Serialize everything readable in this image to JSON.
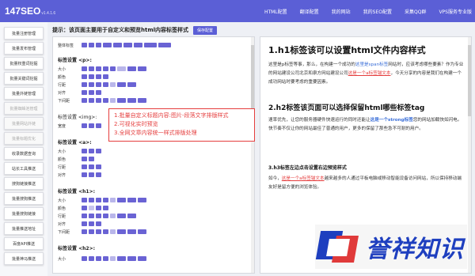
{
  "app": {
    "name": "147SEO",
    "version": "v1.4.1.6"
  },
  "nav": [
    "HTML配置",
    "翻译配置",
    "我的网站",
    "我的SEO配置",
    "采集QQ群",
    "VPS服务专业版"
  ],
  "sidebar": [
    "批量注册管理",
    "批量发布管理",
    "批量权重词挖掘",
    "批量关键词挖掘",
    "批量外链管理",
    "批量蜘蛛池管理",
    "批量网站外链",
    "批量标题优化",
    "收录数据查询",
    "站长工具推送",
    "搜狗链接推送",
    "批量搜狗推送",
    "批量搜狗链接",
    "批量推送地址",
    "百度API推送",
    "批量神马推送"
  ],
  "hint": {
    "text": "提示：该页面主要用于自定义和预览html内容标签样式",
    "save": "保存配置"
  },
  "left": {
    "global_label": "整体标签",
    "sections": [
      {
        "title": "标签设置 <p>:",
        "rows": [
          "大小",
          "颜色",
          "行距",
          "对齐",
          "下间距"
        ]
      },
      {
        "title": "标签设置 <img>:",
        "rows": [
          "宽度"
        ]
      },
      {
        "title": "标签设置 <a>:",
        "rows": [
          "大小",
          "颜色",
          "行距",
          "对齐"
        ]
      },
      {
        "title": "标签设置 <h1>:",
        "rows": [
          "大小",
          "颜色",
          "行距",
          "对齐",
          "下间距"
        ]
      },
      {
        "title": "标签设置 <h2>:",
        "rows": [
          "大小"
        ]
      }
    ],
    "annotation": [
      "1.批量自定义标题内容:图片-段落文字排版样式",
      "2.可视化实时预览",
      "3.全网文章内容统一样式排版处理"
    ]
  },
  "right": {
    "h1": "1.h1标签该可以设置html文件内容样式",
    "p1a": "这里是p标签等事，那么，在构建一个成功的",
    "p1b": "这里是span标签",
    "p1c": "网站时，应该考虑哪些要素？作为专业的网站建设公司北京和泉方网站建设公司",
    "p1d": "这是一个a标签锚文本",
    "p1e": "，今天分享的内容是我们在构建一个成功网站时要考虑的重要因素。",
    "h2": "2.h2标签该页面可以选择保留html哪些标签tag",
    "p2a": "速率优先，让您的服务器硬件快速运行的同时还能让",
    "p2b": "这是一个strong标签",
    "p2c": "您的网站加载快如闪电。快节奏不仅让你的网站最佳了普通的用户，更多的保留了那些急不可耐的用户。",
    "h3": "3.h3标签左边点击设置右边预览样式",
    "p3a": "如今，",
    "p3b": "这是一个a标签锚文本",
    "p3c": "越来越多的人通过平板电脑或移动智能设备访问网站，所以保持移动端友好是留方便的浏览体验。"
  },
  "watermark": "誉祥知识"
}
